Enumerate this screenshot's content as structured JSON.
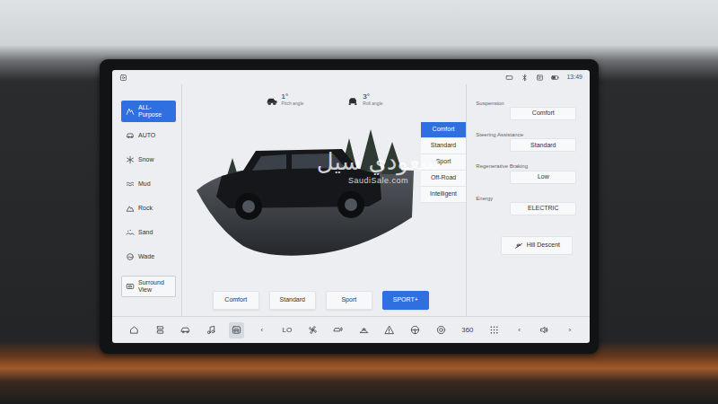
{
  "screen": {
    "time": "13:49"
  },
  "sidebar": {
    "items": [
      {
        "label": "ALL-Purpose",
        "selected": true
      },
      {
        "label": "AUTO",
        "selected": false
      },
      {
        "label": "Snow",
        "selected": false
      },
      {
        "label": "Mud",
        "selected": false
      },
      {
        "label": "Rock",
        "selected": false
      },
      {
        "label": "Sand",
        "selected": false
      },
      {
        "label": "Wade",
        "selected": false
      },
      {
        "label": "Surround View",
        "selected": false
      }
    ]
  },
  "angles": [
    {
      "value": "1°",
      "label": "Pitch angle"
    },
    {
      "value": "3°",
      "label": "Roll angle"
    }
  ],
  "modes": [
    {
      "label": "Comfort",
      "selected": true
    },
    {
      "label": "Standard",
      "selected": false
    },
    {
      "label": "Sport",
      "selected": false
    },
    {
      "label": "Off-Road",
      "selected": false
    },
    {
      "label": "Intelligent",
      "selected": false
    }
  ],
  "drive_modes": [
    {
      "label": "Comfort",
      "selected": false
    },
    {
      "label": "Standard",
      "selected": false
    },
    {
      "label": "Sport",
      "selected": false
    },
    {
      "label": "SPORT+",
      "selected": true
    }
  ],
  "settings": [
    {
      "label": "Suspension",
      "value": "Comfort"
    },
    {
      "label": "Steering Assistance",
      "value": "Standard"
    },
    {
      "label": "Regenerative Braking",
      "value": "Low"
    },
    {
      "label": "Energy",
      "value": "ELECTRIC"
    }
  ],
  "hill_descent": {
    "label": "Hill Descent"
  },
  "watermark": {
    "brand": "سعودي سيل",
    "site": "SaudiSale.com"
  },
  "dock": [
    {
      "kind": "icon",
      "selected": false
    },
    {
      "kind": "icon",
      "selected": false
    },
    {
      "kind": "icon",
      "selected": false
    },
    {
      "kind": "icon",
      "selected": false
    },
    {
      "kind": "icon",
      "selected": true
    },
    {
      "kind": "text",
      "text": "‹",
      "selected": false
    },
    {
      "kind": "text",
      "text": "LO",
      "selected": false
    },
    {
      "kind": "icon",
      "selected": false
    },
    {
      "kind": "icon",
      "selected": false
    },
    {
      "kind": "icon",
      "selected": false
    },
    {
      "kind": "icon",
      "selected": false
    },
    {
      "kind": "icon",
      "selected": false
    },
    {
      "kind": "icon",
      "selected": false
    },
    {
      "kind": "text",
      "text": "360",
      "selected": false
    },
    {
      "kind": "icon",
      "selected": false
    },
    {
      "kind": "text",
      "text": "‹",
      "selected": false
    },
    {
      "kind": "icon",
      "selected": false
    },
    {
      "kind": "text",
      "text": "›",
      "selected": false
    }
  ]
}
